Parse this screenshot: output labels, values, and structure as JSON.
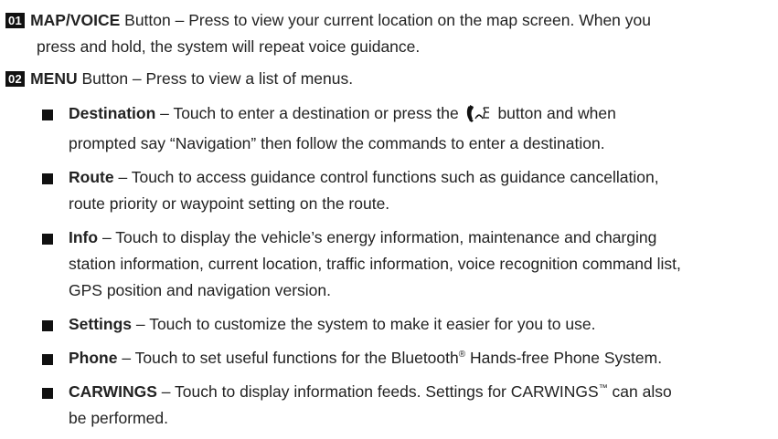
{
  "items": [
    {
      "number": "01",
      "label": "MAP/VOICE",
      "text_line1": " Button – Press to view your current location on the map screen. When you",
      "text_line2": "press and hold, the system will repeat voice guidance."
    },
    {
      "number": "02",
      "label": "MENU",
      "text_line1": " Button – Press to view a list of menus."
    }
  ],
  "menu_items": {
    "destination": {
      "label": "Destination",
      "text_before_icon": " – Touch to enter a destination or press the ",
      "icon": "voice-talk-icon",
      "text_after_icon": " button and when",
      "line2": "prompted say “Navigation” then follow the commands to enter a destination."
    },
    "route": {
      "label": "Route",
      "text": " – Touch to access guidance control functions such as guidance cancellation,",
      "line2": "route priority or waypoint setting on the route."
    },
    "info": {
      "label": "Info",
      "text": " – Touch to display the vehicle’s energy information, maintenance and charging",
      "line2": "station information, current location, traffic information, voice recognition command list,",
      "line3": "GPS position and navigation version."
    },
    "settings": {
      "label": "Settings",
      "text": " – Touch to customize the system to make it easier for you to use."
    },
    "phone": {
      "label": "Phone",
      "text_before_sup": " – Touch to set useful functions for the Bluetooth",
      "sup": "®",
      "text_after_sup": " Hands-free Phone System."
    },
    "carwings": {
      "label": "CARWINGS",
      "text_before_sup": " – Touch to display information feeds. Settings for CARWINGS",
      "sup": "™",
      "text_after_sup": " can also",
      "line2": "be performed."
    }
  }
}
